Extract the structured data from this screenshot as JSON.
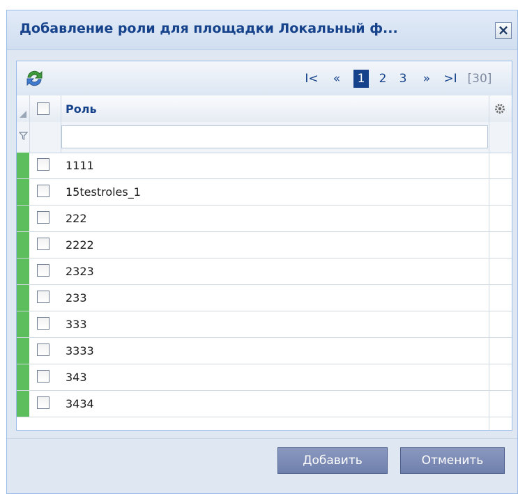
{
  "window": {
    "title": "Добавление роли для площадки Локальный ф...",
    "close_icon": "×"
  },
  "toolbar": {
    "refresh_icon": "refresh-icon",
    "pager": {
      "first": "I<",
      "prev": "«",
      "pages": [
        "1",
        "2",
        "3"
      ],
      "current": "1",
      "next": "»",
      "last": ">I",
      "total": "[30]"
    }
  },
  "grid": {
    "column_header": "Роль",
    "settings_icon": "gear-icon",
    "filter_icon": "filter-icon",
    "filter_value": "",
    "rows": [
      "1111",
      "15testroles_1",
      "222",
      "2222",
      "2323",
      "233",
      "333",
      "3333",
      "343",
      "3434"
    ],
    "row_marker_color": "#5cbe5c"
  },
  "buttons": {
    "add": "Добавить",
    "cancel": "Отменить"
  }
}
